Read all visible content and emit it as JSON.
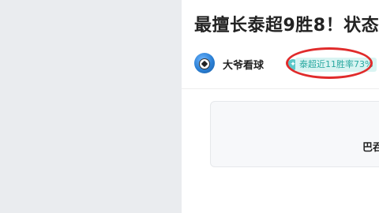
{
  "article": {
    "title": "最擅长泰超9胜8！状态",
    "author": {
      "name": "大爷看球",
      "avatar_icon": "soccer-ball-avatar"
    },
    "stat_tag": "泰超近11胜率73%",
    "card_text": "巴吞"
  },
  "colors": {
    "stat_tag_bg": "#d9f4f2",
    "stat_tag_text": "#2aa9a1",
    "highlight_circle": "#e02b2b",
    "orange_tag": "#f6a23c"
  }
}
